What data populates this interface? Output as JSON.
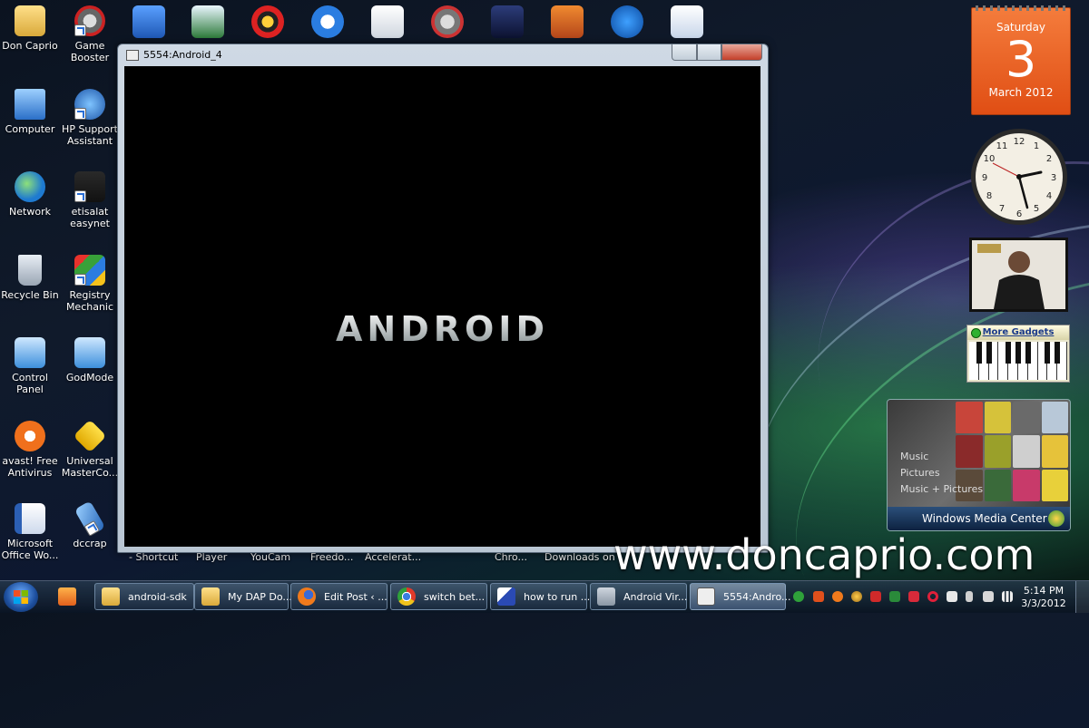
{
  "desktop_icons": [
    {
      "label": "Don Caprio"
    },
    {
      "label": "Game Booster"
    },
    {
      "label": "Computer"
    },
    {
      "label": "HP Support Assistant"
    },
    {
      "label": "Network"
    },
    {
      "label": "etisalat easynet"
    },
    {
      "label": "Recycle Bin"
    },
    {
      "label": "Registry Mechanic"
    },
    {
      "label": "Control Panel"
    },
    {
      "label": "GodMode"
    },
    {
      "label": "avast! Free Antivirus"
    },
    {
      "label": "Universal MasterCo..."
    },
    {
      "label": "Microsoft Office Wo..."
    },
    {
      "label": "dccrap"
    }
  ],
  "bottom_labels": [
    "- Shortcut",
    "Player",
    "YouCam",
    "Freedo...",
    "Accelerat...",
    "Chro...",
    "Downloads",
    "on"
  ],
  "window": {
    "title": "5554:Android_4",
    "boot_text": "ANDROID"
  },
  "calendar": {
    "day": "Saturday",
    "date": "3",
    "month": "March 2012"
  },
  "piano": {
    "link": "More Gadgets"
  },
  "media_center": {
    "items": [
      "Music",
      "Pictures",
      "Music + Pictures"
    ],
    "brand": "Windows Media Center"
  },
  "watermark": "www.doncaprio.com",
  "taskbar": {
    "buttons": [
      {
        "label": "android-sdk"
      },
      {
        "label": "My DAP Do..."
      },
      {
        "label": "Edit Post ‹ ..."
      },
      {
        "label": "switch bet..."
      },
      {
        "label": "how to run ..."
      },
      {
        "label": "Android Vir..."
      },
      {
        "label": "5554:Andro..."
      }
    ],
    "time": "5:14 PM",
    "date": "3/3/2012"
  },
  "colors": {
    "calendar_orange": "#e8581c",
    "taskbar": "#1b2a3c",
    "close_red": "#c4402a"
  }
}
